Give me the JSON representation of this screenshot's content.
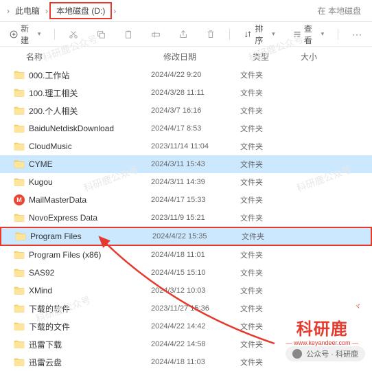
{
  "breadcrumb": {
    "item1": "此电脑",
    "item2": "本地磁盘 (D:)",
    "search_hint": "在 本地磁盘"
  },
  "toolbar": {
    "new": "新建",
    "sort": "排序",
    "view": "查看"
  },
  "headers": {
    "name": "名称",
    "date": "修改日期",
    "type": "类型",
    "size": "大小"
  },
  "files": [
    {
      "name": "000.工作站",
      "date": "2024/4/22 9:20",
      "type": "文件夹",
      "icon": "folder"
    },
    {
      "name": "100.理工相关",
      "date": "2024/3/28 11:11",
      "type": "文件夹",
      "icon": "folder"
    },
    {
      "name": "200.个人相关",
      "date": "2024/3/7 16:16",
      "type": "文件夹",
      "icon": "folder"
    },
    {
      "name": "BaiduNetdiskDownload",
      "date": "2024/4/17 8:53",
      "type": "文件夹",
      "icon": "folder"
    },
    {
      "name": "CloudMusic",
      "date": "2023/11/14 11:04",
      "type": "文件夹",
      "icon": "folder"
    },
    {
      "name": "CYME",
      "date": "2024/3/11 15:43",
      "type": "文件夹",
      "icon": "folder",
      "selected": true
    },
    {
      "name": "Kugou",
      "date": "2024/3/11 14:39",
      "type": "文件夹",
      "icon": "folder"
    },
    {
      "name": "MailMasterData",
      "date": "2024/4/17 15:33",
      "type": "文件夹",
      "icon": "mail"
    },
    {
      "name": "NovoExpress Data",
      "date": "2023/11/9 15:21",
      "type": "文件夹",
      "icon": "folder"
    },
    {
      "name": "Program Files",
      "date": "2024/4/22 15:35",
      "type": "文件夹",
      "icon": "folder",
      "selected": true,
      "highlight": true
    },
    {
      "name": "Program Files (x86)",
      "date": "2024/4/18 11:01",
      "type": "文件夹",
      "icon": "folder"
    },
    {
      "name": "SAS92",
      "date": "2024/4/15 15:10",
      "type": "文件夹",
      "icon": "folder"
    },
    {
      "name": "XMind",
      "date": "2024/3/12 10:03",
      "type": "文件夹",
      "icon": "folder"
    },
    {
      "name": "下载的软件",
      "date": "2023/11/27 15:36",
      "type": "文件夹",
      "icon": "folder"
    },
    {
      "name": "下载的文件",
      "date": "2024/4/22 14:42",
      "type": "文件夹",
      "icon": "folder"
    },
    {
      "name": "迅雷下载",
      "date": "2024/4/22 14:58",
      "type": "文件夹",
      "icon": "folder"
    },
    {
      "name": "迅雷云盘",
      "date": "2024/4/18 11:03",
      "type": "文件夹",
      "icon": "folder"
    }
  ],
  "watermark": {
    "main": "科研鹿",
    "sub": "— www.keyandeer.com —",
    "antlers": "ヾ"
  },
  "footer": {
    "label": "公众号 · 科研鹿"
  },
  "bg_watermark": "科研鹿公众号"
}
